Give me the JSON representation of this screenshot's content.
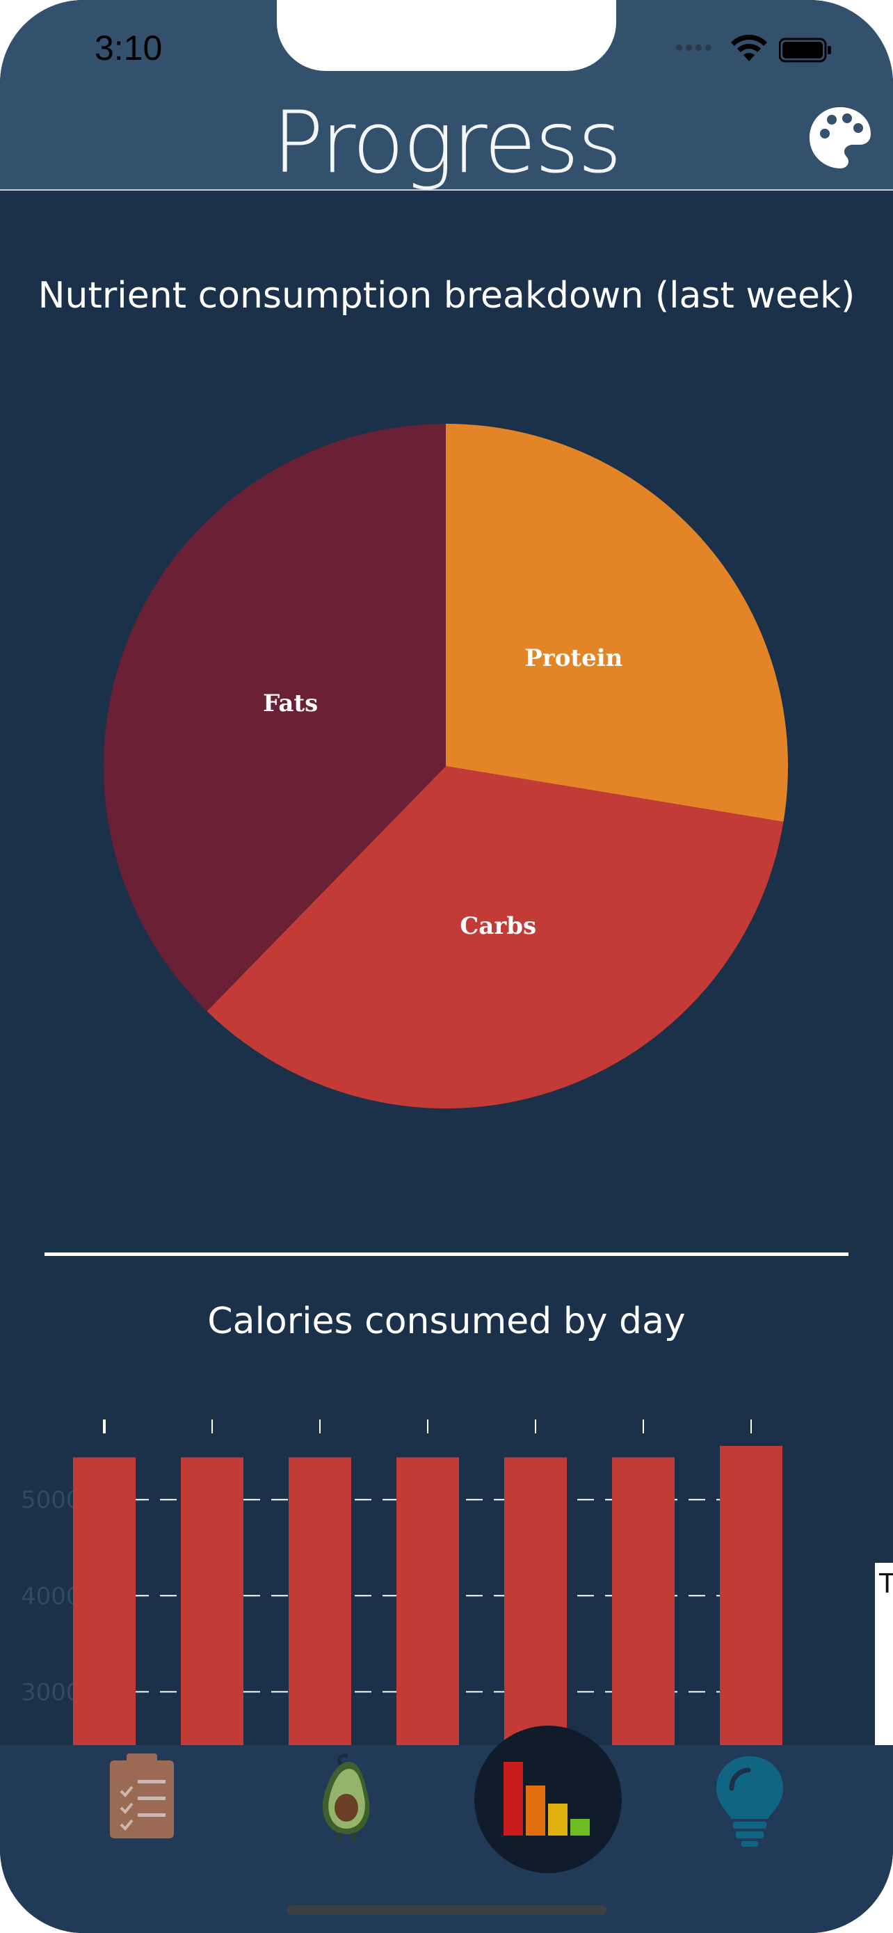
{
  "status_bar": {
    "time": "3:10"
  },
  "header": {
    "title": "Progress",
    "theme_icon": "palette-icon"
  },
  "nutrient_section": {
    "title": "Nutrient consumption breakdown (last week)"
  },
  "calories_section": {
    "title": "Calories consumed by day"
  },
  "chart_data": [
    {
      "type": "pie",
      "title": "Nutrient consumption breakdown (last week)",
      "slices": [
        {
          "label": "Protein",
          "value": 27.6,
          "color": "#e38427"
        },
        {
          "label": "Carbs",
          "value": 34.7,
          "color": "#c23b37"
        },
        {
          "label": "Fats",
          "value": 37.7,
          "color": "#6a2035"
        }
      ]
    },
    {
      "type": "bar",
      "title": "Calories consumed by day",
      "categories": [
        "",
        "",
        "",
        "",
        "",
        "",
        ""
      ],
      "values": [
        5440,
        5440,
        5440,
        5440,
        5440,
        5440,
        5560
      ],
      "color": "#c23b37",
      "yticks": [
        "3000",
        "4000",
        "5000"
      ],
      "visible_ylim": [
        2430,
        5690
      ],
      "grid": true
    }
  ],
  "legend_fragment": "T",
  "tabs": [
    {
      "name": "log",
      "icon": "clipboard-icon"
    },
    {
      "name": "food",
      "icon": "avocado-icon"
    },
    {
      "name": "progress",
      "icon": "bar-chart-icon",
      "selected": true
    },
    {
      "name": "tips",
      "icon": "lightbulb-icon"
    }
  ]
}
